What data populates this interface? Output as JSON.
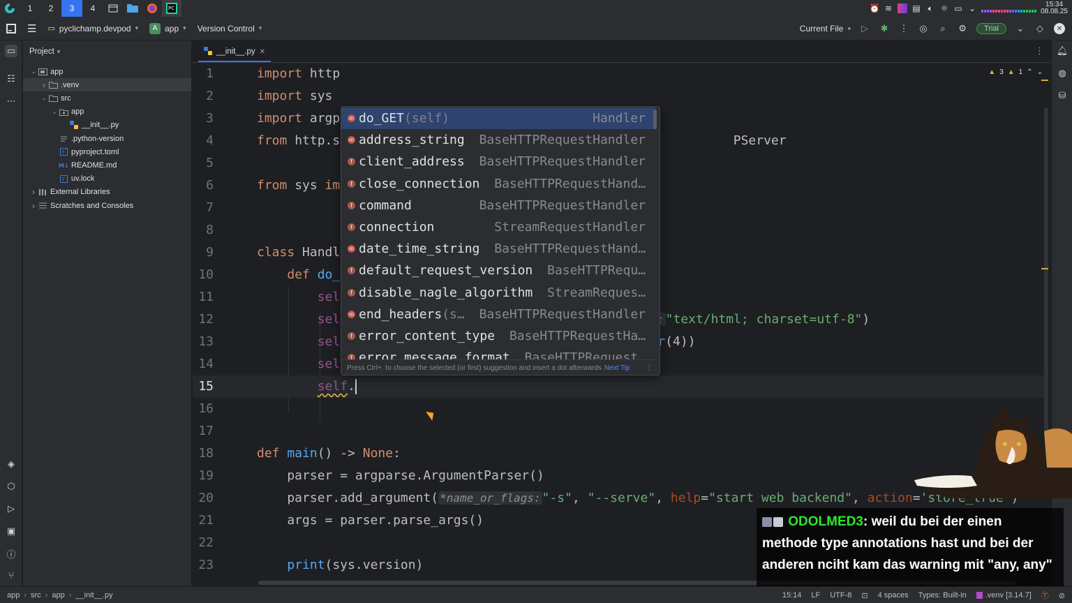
{
  "taskbar": {
    "workspaces": [
      "1",
      "2",
      "3",
      "4"
    ],
    "active_workspace": "3",
    "clock_time": "15:34",
    "clock_date": "08.08.25"
  },
  "toolbar": {
    "project_name": "pyclichamp.devpod",
    "module_badge": "A",
    "module_name": "app",
    "vcs_label": "Version Control",
    "run_config": "Current File",
    "trial_label": "Trial"
  },
  "project_panel": {
    "title": "Project",
    "tree": [
      {
        "label": "app",
        "depth": 0,
        "kind": "module",
        "expanded": true
      },
      {
        "label": ".venv",
        "depth": 1,
        "kind": "folder",
        "expanded": false,
        "selected": true
      },
      {
        "label": "src",
        "depth": 1,
        "kind": "folder",
        "expanded": true
      },
      {
        "label": "app",
        "depth": 2,
        "kind": "package",
        "expanded": true
      },
      {
        "label": "__init__.py",
        "depth": 3,
        "kind": "python"
      },
      {
        "label": ".python-version",
        "depth": 2,
        "kind": "text"
      },
      {
        "label": "pyproject.toml",
        "depth": 2,
        "kind": "toml"
      },
      {
        "label": "README.md",
        "depth": 2,
        "kind": "markdown"
      },
      {
        "label": "uv.lock",
        "depth": 2,
        "kind": "lock"
      },
      {
        "label": "External Libraries",
        "depth": 0,
        "kind": "library",
        "expanded": false
      },
      {
        "label": "Scratches and Consoles",
        "depth": 0,
        "kind": "scratch",
        "expanded": false
      }
    ]
  },
  "editor": {
    "tab_label": "__init__.py",
    "inspections": {
      "warnings": "3",
      "weak_warnings": "1"
    },
    "current_line": 15,
    "lines": [
      {
        "n": "1",
        "parts": [
          [
            "kw",
            "import"
          ],
          [
            "tx",
            " http"
          ]
        ]
      },
      {
        "n": "2",
        "parts": [
          [
            "kw",
            "import"
          ],
          [
            "tx",
            " sys"
          ]
        ]
      },
      {
        "n": "3",
        "parts": [
          [
            "kw",
            "import"
          ],
          [
            "tx",
            " argp"
          ]
        ]
      },
      {
        "n": "4",
        "parts": [
          [
            "kw",
            "from"
          ],
          [
            "tx",
            " http.s"
          ],
          [
            "tx",
            "                                                    PServer"
          ]
        ]
      },
      {
        "n": "5",
        "parts": []
      },
      {
        "n": "6",
        "parts": [
          [
            "kw",
            "from"
          ],
          [
            "tx",
            " sys "
          ],
          [
            "kw",
            "im"
          ]
        ]
      },
      {
        "n": "7",
        "parts": []
      },
      {
        "n": "8",
        "parts": []
      },
      {
        "n": "9",
        "parts": [
          [
            "kw",
            "class"
          ],
          [
            "tx",
            " Handl"
          ]
        ]
      },
      {
        "n": "10",
        "parts": [
          [
            "tx",
            "    "
          ],
          [
            "kw",
            "def"
          ],
          [
            "fn",
            " do_"
          ]
        ]
      },
      {
        "n": "11",
        "parts": [
          [
            "tx",
            "        "
          ],
          [
            "sf",
            "sel"
          ]
        ]
      },
      {
        "n": "12",
        "parts": [
          [
            "tx",
            "        "
          ],
          [
            "sf",
            "sel"
          ],
          [
            "tx",
            "                                        "
          ],
          [
            "hint",
            "ue:"
          ],
          [
            "st",
            "\"text/html; charset=utf-8\""
          ],
          [
            "tx",
            ")"
          ]
        ]
      },
      {
        "n": "13",
        "parts": [
          [
            "tx",
            "        "
          ],
          [
            "sf",
            "sel"
          ],
          [
            "tx",
            "                                        "
          ],
          [
            "fn",
            "str"
          ],
          [
            "tx",
            "(4))"
          ]
        ]
      },
      {
        "n": "14",
        "parts": [
          [
            "tx",
            "        "
          ],
          [
            "sf",
            "sel"
          ]
        ]
      },
      {
        "n": "15",
        "parts": [
          [
            "tx",
            "        "
          ],
          [
            "sq",
            "self"
          ],
          [
            "tx",
            "."
          ],
          [
            "caret",
            ""
          ]
        ]
      },
      {
        "n": "16",
        "parts": []
      },
      {
        "n": "17",
        "parts": []
      },
      {
        "n": "18",
        "parts": [
          [
            "kw",
            "def"
          ],
          [
            "fn",
            " main"
          ],
          [
            "tx",
            "() -> "
          ],
          [
            "kw",
            "None"
          ],
          [
            "tx",
            ":"
          ]
        ]
      },
      {
        "n": "19",
        "parts": [
          [
            "tx",
            "    parser = argparse.ArgumentParser()"
          ]
        ]
      },
      {
        "n": "20",
        "parts": [
          [
            "tx",
            "    parser.add_argument("
          ],
          [
            "hint",
            "*name_or_flags:"
          ],
          [
            "st",
            "\"-s\""
          ],
          [
            "tx",
            ", "
          ],
          [
            "st",
            "\"--serve\""
          ],
          [
            "tx",
            ", "
          ],
          [
            "param",
            "help"
          ],
          [
            "tx",
            "="
          ],
          [
            "st",
            "\"start web backend\""
          ],
          [
            "tx",
            ", "
          ],
          [
            "param",
            "action"
          ],
          [
            "tx",
            "="
          ],
          [
            "st",
            "'store_true'"
          ],
          [
            "tx",
            ")"
          ]
        ]
      },
      {
        "n": "21",
        "parts": [
          [
            "tx",
            "    args = parser.parse_args()"
          ]
        ]
      },
      {
        "n": "22",
        "parts": []
      },
      {
        "n": "23",
        "parts": [
          [
            "tx",
            "    "
          ],
          [
            "fn",
            "print"
          ],
          [
            "tx",
            "(sys.version)"
          ]
        ]
      }
    ]
  },
  "completion": {
    "items": [
      {
        "name": "do_GET",
        "args": "(self)",
        "type": "Handler",
        "kind": "method",
        "selected": true
      },
      {
        "name": "address_string",
        "args": "",
        "type": "BaseHTTPRequestHandler",
        "kind": "method"
      },
      {
        "name": "client_address",
        "args": "",
        "type": "BaseHTTPRequestHandler",
        "kind": "field"
      },
      {
        "name": "close_connection",
        "args": "",
        "type": "BaseHTTPRequestHand…",
        "kind": "field"
      },
      {
        "name": "command",
        "args": "",
        "type": "BaseHTTPRequestHandler",
        "kind": "field"
      },
      {
        "name": "connection",
        "args": "",
        "type": "StreamRequestHandler",
        "kind": "field"
      },
      {
        "name": "date_time_string",
        "args": "",
        "type": "BaseHTTPRequestHand…",
        "kind": "method"
      },
      {
        "name": "default_request_version",
        "args": "",
        "type": "BaseHTTPRequ…",
        "kind": "field"
      },
      {
        "name": "disable_nagle_algorithm",
        "args": "",
        "type": "StreamReques…",
        "kind": "field"
      },
      {
        "name": "end_headers",
        "args": "(s…",
        "type": "BaseHTTPRequestHandler",
        "kind": "method"
      },
      {
        "name": "error_content_type",
        "args": "",
        "type": "BaseHTTPRequestHa…",
        "kind": "field"
      },
      {
        "name": "error_message_format",
        "args": "",
        "type": "BaseHTTPRequest…",
        "kind": "field"
      }
    ],
    "footer_hint": "Press Ctrl+. to choose the selected (or first) suggestion and insert a dot afterwards",
    "next_tip": "Next Tip"
  },
  "statusbar": {
    "breadcrumbs": [
      "app",
      "src",
      "app",
      "__init__.py"
    ],
    "position": "15:14",
    "line_separator": "LF",
    "encoding": "UTF-8",
    "indent": "4 spaces",
    "types": "Types: Built-in",
    "interpreter": ".venv [3.14.7]"
  },
  "chat": {
    "user": "ODOLMED3",
    "message": "weil du bei der einen methode type annotations hast und bei der anderen nciht kam das warning mit \"any, any\""
  }
}
